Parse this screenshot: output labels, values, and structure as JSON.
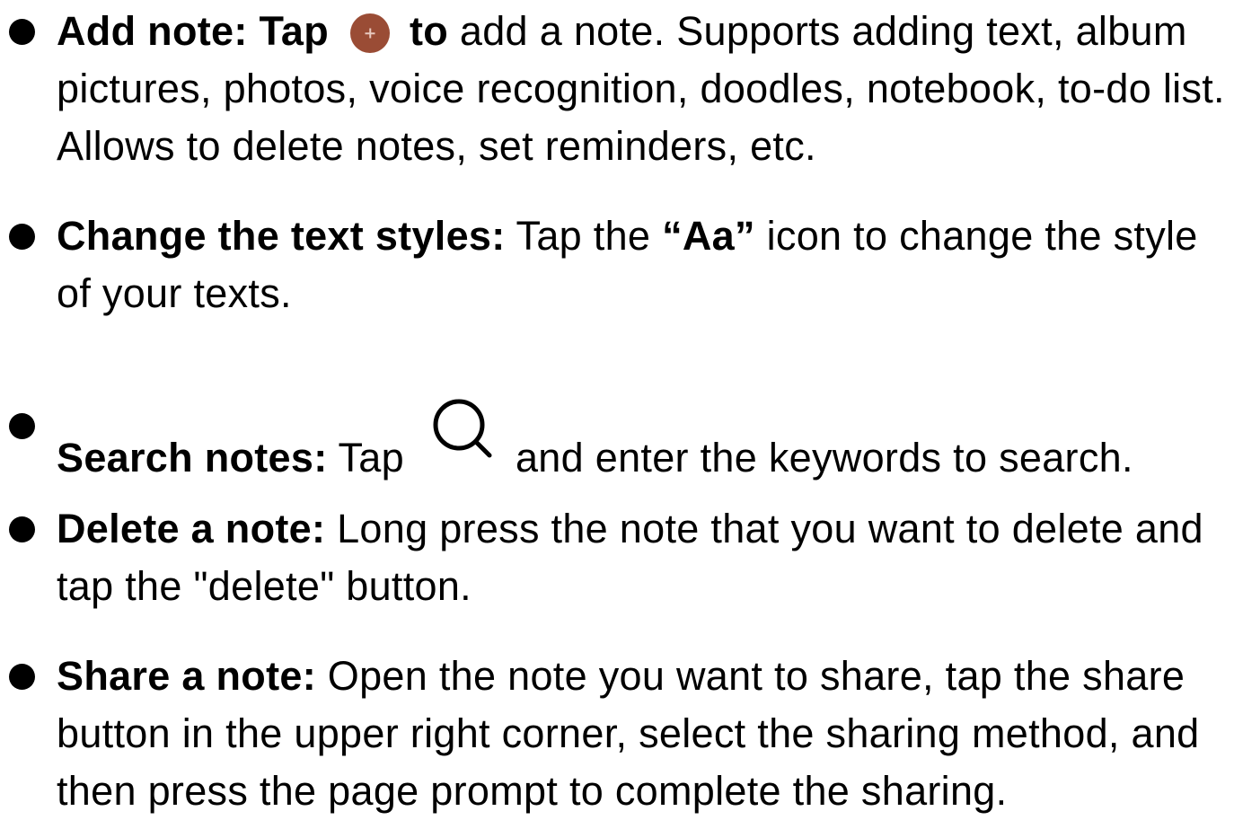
{
  "items": [
    {
      "label": "Add note: Tap",
      "label_after_icon": "to",
      "text": "add a note. Supports adding text, album pictures, photos, voice recognition, doodles, notebook, to-do list. Allows to delete notes, set reminders, etc.",
      "icon": "plus-icon",
      "icon_color": "#9a4c35"
    },
    {
      "label": "Change the text styles:",
      "text_before": "Tap the",
      "highlight": "“Aa”",
      "text_after": "icon to change the style of your texts."
    },
    {
      "label": "Search notes:",
      "text_before": "Tap",
      "icon": "search-icon",
      "text_after": "and enter the keywords to search."
    },
    {
      "label": "Delete a note:",
      "text": "Long press the note that you want to delete and tap the \"delete\" button."
    },
    {
      "label": "Share a note:",
      "text": "Open the note you want to share, tap the share button in the upper right corner, select the sharing method, and then press the page prompt to complete the sharing."
    }
  ]
}
